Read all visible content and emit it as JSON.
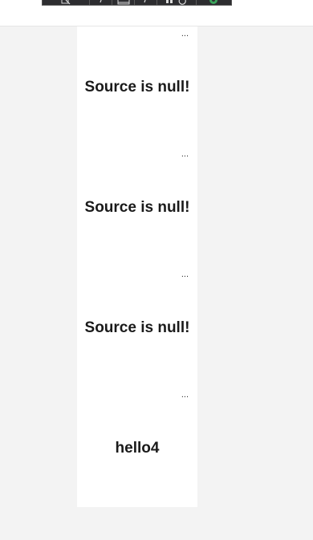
{
  "toolbar": {
    "icons": [
      "select-element-icon",
      "step-icon",
      "frame-icon",
      "step-icon",
      "pause-icon",
      "refresh-icon",
      "hot-reload-icon"
    ]
  },
  "items": [
    {
      "ellipsis": "...",
      "text": "Source is null!"
    },
    {
      "ellipsis": "...",
      "text": "Source is null!"
    },
    {
      "ellipsis": "...",
      "text": "Source is null!"
    },
    {
      "ellipsis": "...",
      "text": "hello4"
    }
  ]
}
